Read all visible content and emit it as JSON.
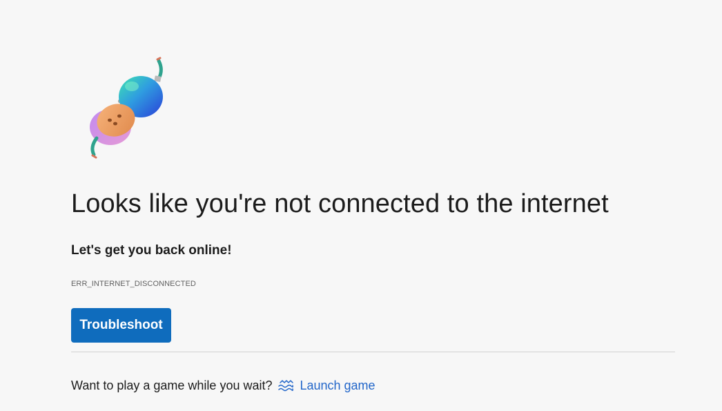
{
  "error_page": {
    "headline": "Looks like you're not connected to the internet",
    "subhead": "Let's get you back online!",
    "error_code": "ERR_INTERNET_DISCONNECTED",
    "troubleshoot_label": "Troubleshoot",
    "game_prompt": "Want to play a game while you wait?",
    "launch_game_label": "Launch game",
    "icons": {
      "illustration": "unplugged-plug-illustration",
      "game": "surf-waves-icon"
    },
    "colors": {
      "background": "#f7f7f7",
      "primary_button": "#0f6cbd",
      "link": "#2266c9",
      "text": "#1b1b1b"
    }
  }
}
